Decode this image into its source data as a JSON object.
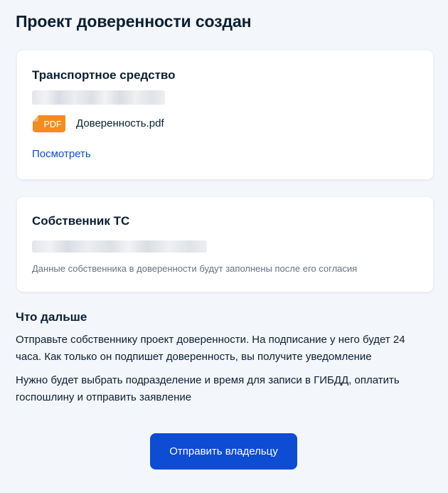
{
  "page": {
    "title": "Проект доверенности создан"
  },
  "vehicle_card": {
    "title": "Транспортное средство",
    "file": {
      "icon": "pdf-file-icon",
      "badge": "PDF",
      "name": "Доверенность.pdf"
    },
    "view_link": "Посмотреть"
  },
  "owner_card": {
    "title": "Собственник ТС",
    "note": "Данные собственника в доверенности будут заполнены после его согласия"
  },
  "next_steps": {
    "heading": "Что дальше",
    "paragraphs": [
      "Отправьте собственнику проект доверенности. На подписание у него будет 24 часа. Как только он подпишет доверенность, вы получите уведомление",
      "Нужно будет выбрать подразделение и время для записи в ГИБДД, оплатить госпошлину и отправить заявление"
    ]
  },
  "actions": {
    "send_label": "Отправить владельцу"
  },
  "colors": {
    "background": "#f3f6fb",
    "card": "#ffffff",
    "accent": "#0d4cd3",
    "text": "#0b1f33",
    "muted": "#66727f",
    "pdf_badge": "#f28d1e"
  }
}
